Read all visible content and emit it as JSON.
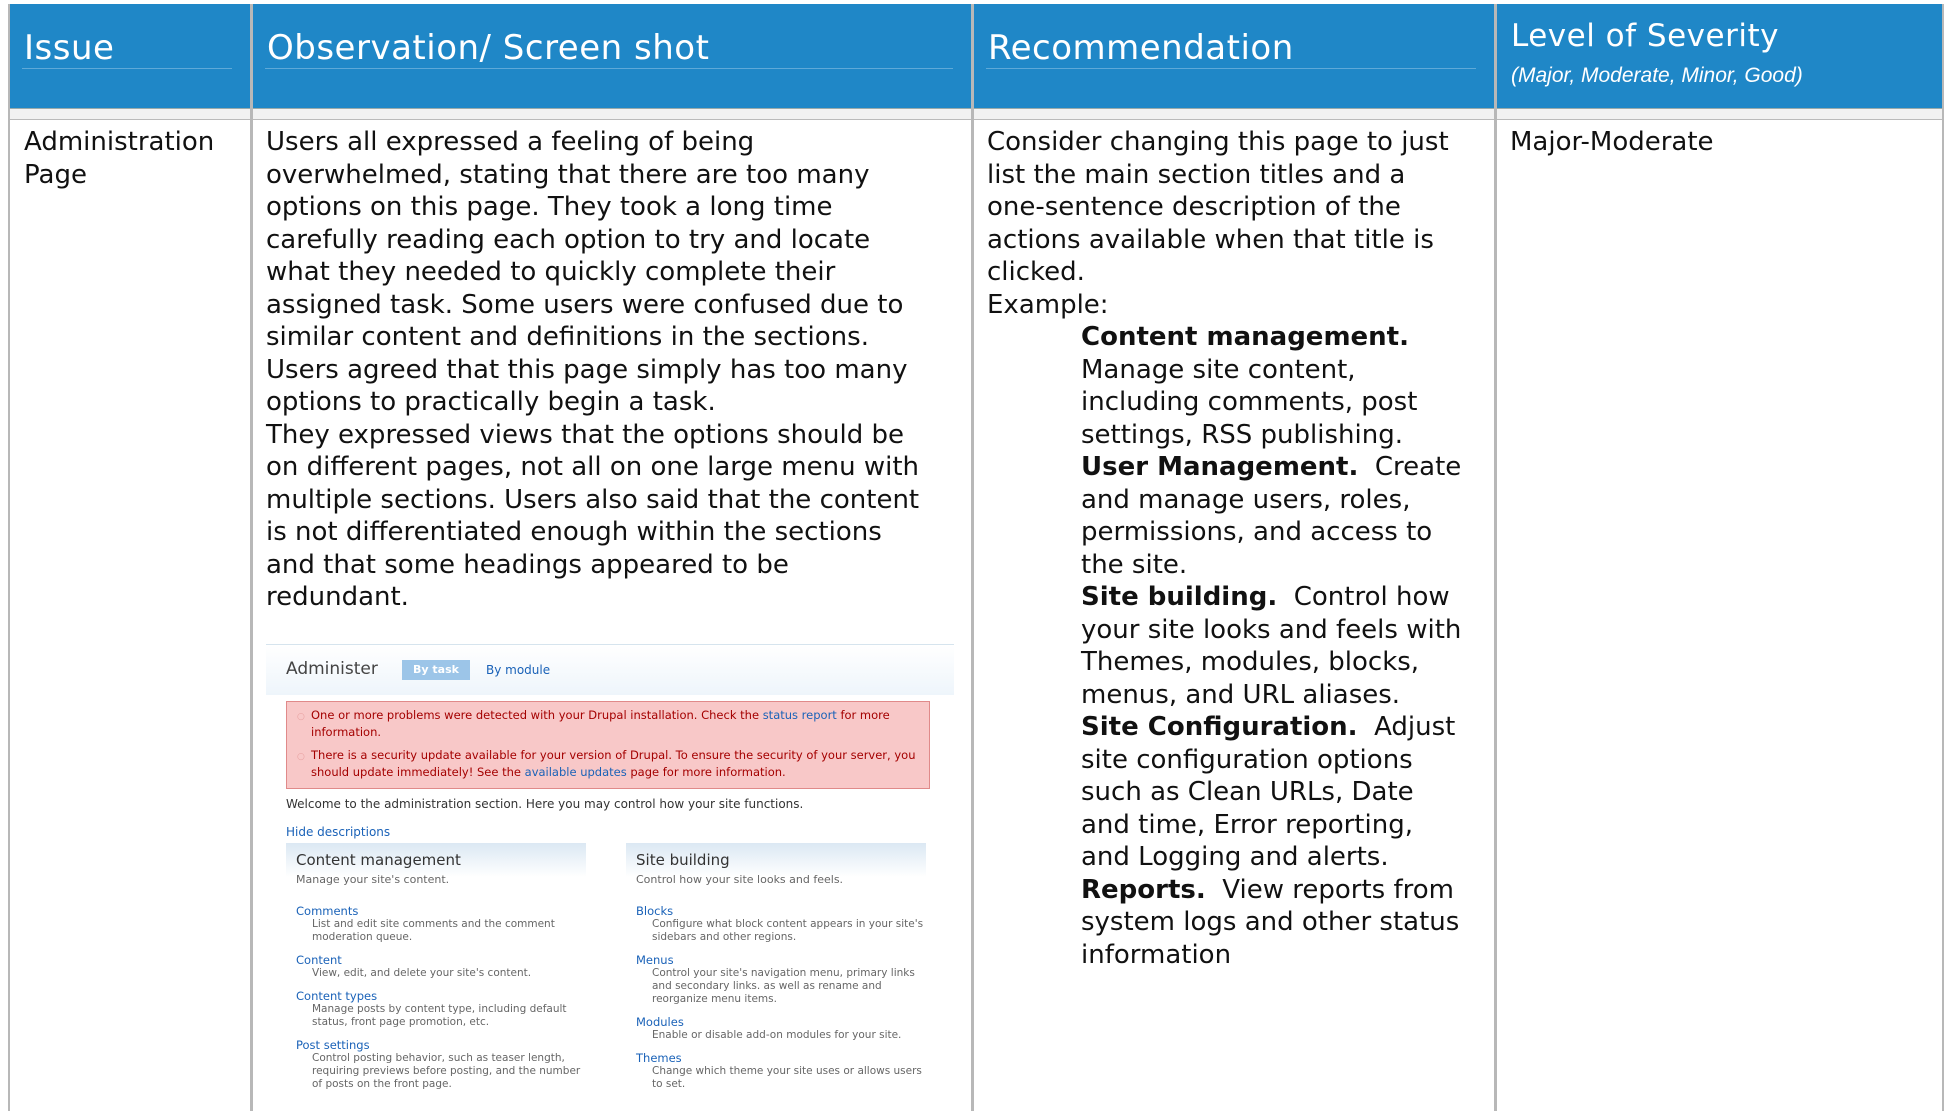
{
  "headers": {
    "issue": "Issue",
    "observation": "Observation/ Screen shot",
    "recommendation": "Recommendation",
    "severity": "Level of Severity",
    "severity_sub": "(Major, Moderate, Minor, Good)"
  },
  "row": {
    "issue": [
      "Administration",
      "Page"
    ],
    "observation_lines": [
      "Users all expressed a feeling of being",
      "overwhelmed, stating that there are too many",
      "options on this page.  They took a long time",
      "carefully reading each option to try and locate",
      "what they needed to quickly complete their",
      "assigned task.  Some users were confused due to",
      "similar content and definitions in the sections.",
      "Users agreed that this page simply has too many",
      "options to practically begin a task.",
      "They expressed views that the options should be",
      "on different pages, not all on one large menu with",
      "multiple sections.  Users also said that the content",
      "is not differentiated enough within the sections",
      "and that some headings appeared to be",
      "redundant."
    ],
    "recommendation_intro": [
      "Consider changing this page to just",
      "list the main section titles and a",
      "one-sentence description of the",
      "actions available when that title is",
      "clicked.",
      "Example:"
    ],
    "example_sections": [
      {
        "title": "Content management.",
        "lines": [
          "",
          "Manage site content,",
          "including comments, post",
          "settings, RSS publishing."
        ]
      },
      {
        "title": "User Management.",
        "lines": [
          "  Create",
          "and manage users, roles,",
          "permissions, and access to",
          "the site."
        ]
      },
      {
        "title": "Site building.",
        "lines": [
          "  Control how",
          "your site looks and feels with",
          "Themes, modules, blocks,",
          "menus, and URL aliases."
        ]
      },
      {
        "title": "Site Configuration.",
        "lines": [
          "  Adjust",
          "site configuration options",
          "such as Clean URLs, Date",
          "and time, Error reporting,",
          "and Logging and alerts."
        ]
      },
      {
        "title": "Reports.",
        "lines": [
          "  View reports from",
          "system logs and other status",
          "information"
        ]
      }
    ],
    "severity": "Major-Moderate"
  },
  "screenshot": {
    "title": "Administer",
    "tab_active": "By task",
    "tab_other": "By module",
    "error1_a": "One or more problems were detected with your Drupal installation. Check the ",
    "error1_link": "status report",
    "error1_b": " for more",
    "error1_c": "information.",
    "error2_a": "There is a security update available for your version of Drupal. To ensure the security of your server, you",
    "error2_b": "should update immediately! See the ",
    "error2_link": "available updates",
    "error2_c": " page for more information.",
    "welcome": "Welcome to the administration section. Here you may control how your site functions.",
    "hide": "Hide descriptions",
    "left": {
      "heading": "Content management",
      "desc": "Manage your site's content.",
      "items": [
        {
          "t": "Comments",
          "d1": "List and edit site comments and the comment",
          "d2": "moderation queue."
        },
        {
          "t": "Content",
          "d1": "View, edit, and delete your site's content.",
          "d2": ""
        },
        {
          "t": "Content types",
          "d1": "Manage posts by content type, including default",
          "d2": "status, front page promotion, etc."
        },
        {
          "t": "Post settings",
          "d1": "Control posting behavior, such as teaser length,",
          "d2": "requiring previews before posting, and the number",
          "d3": "of posts on the front page."
        }
      ]
    },
    "right": {
      "heading": "Site building",
      "desc": "Control how your site looks and feels.",
      "items": [
        {
          "t": "Blocks",
          "d1": "Configure what block content appears in your site's",
          "d2": "sidebars and other regions."
        },
        {
          "t": "Menus",
          "d1": "Control your site's navigation menu, primary links",
          "d2": "and secondary links. as well as rename and",
          "d3": "reorganize menu items."
        },
        {
          "t": "Modules",
          "d1": "Enable or disable add-on modules for your site.",
          "d2": ""
        },
        {
          "t": "Themes",
          "d1": "Change which theme your site uses or allows users",
          "d2": "to set."
        }
      ]
    }
  },
  "colors": {
    "header": "#1f87c7",
    "border": "#b8b8b8"
  }
}
